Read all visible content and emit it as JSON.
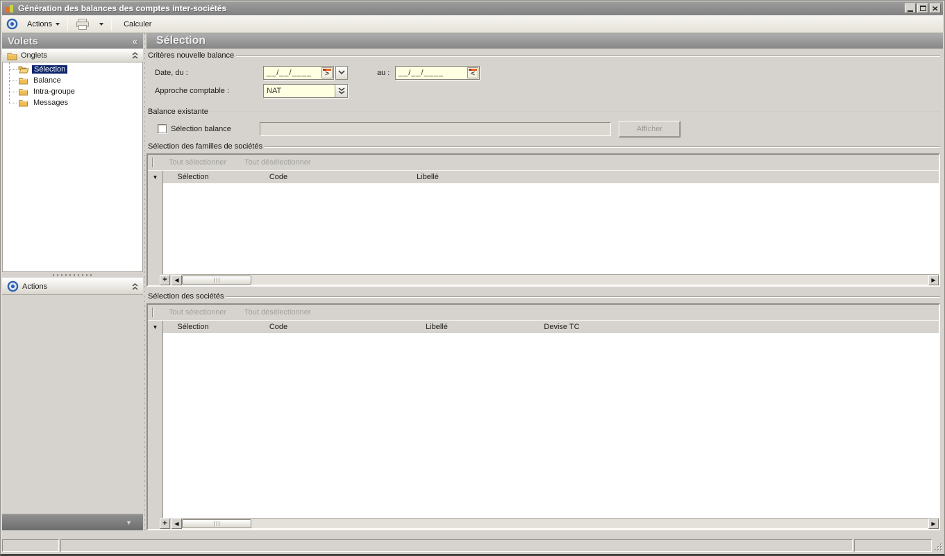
{
  "window": {
    "title": "Génération des balances des comptes inter-sociétés"
  },
  "toolbar": {
    "actions_label": "Actions",
    "calculer_label": "Calculer"
  },
  "sidebar": {
    "title": "Volets",
    "onglets_label": "Onglets",
    "tree": [
      {
        "label": "Sélection",
        "selected": true
      },
      {
        "label": "Balance",
        "selected": false
      },
      {
        "label": "Intra-groupe",
        "selected": false
      },
      {
        "label": "Messages",
        "selected": false
      }
    ],
    "actions_label": "Actions"
  },
  "main": {
    "title": "Sélection",
    "criteres": {
      "legend": "Critères nouvelle balance",
      "date_du_label": "Date, du :",
      "date_du_value": "__/__/____",
      "au_label": "au :",
      "au_value": "__/__/____",
      "approche_label": "Approche comptable :",
      "approche_value": "NAT"
    },
    "balance": {
      "legend": "Balance existante",
      "checkbox_label": "Sélection balance",
      "checkbox_checked": false,
      "input_value": "",
      "afficher_label": "Afficher"
    },
    "familles": {
      "legend": "Sélection des familles de sociétés",
      "select_all": "Tout sélectionner",
      "deselect_all": "Tout désélectionner",
      "columns": [
        "Sélection",
        "Code",
        "Libellé"
      ],
      "rows": []
    },
    "societes": {
      "legend": "Sélection des sociétés",
      "select_all": "Tout sélectionner",
      "deselect_all": "Tout désélectionner",
      "columns": [
        "Sélection",
        "Code",
        "Libellé",
        "Devise TC"
      ],
      "rows": []
    }
  },
  "icons": {
    "collapse_left": "«",
    "row_marker": "▼",
    "add_row": "+",
    "scroll_left": "◀",
    "scroll_right": "▶",
    "cal_next": ">",
    "cal_prev": "<",
    "panel_collapse": "▼"
  },
  "statusbar": {
    "cell1": "",
    "cell2": "",
    "cell3": ""
  },
  "colors": {
    "field_yellow": "#ffffe1",
    "selection_navy": "#0b246b",
    "window_gray": "#d6d3ce",
    "header_gray": "#8c8c8c",
    "accent_orange": "#e8632a",
    "folder_gold": "#f0bd55",
    "target_blue": "#3061ae"
  }
}
